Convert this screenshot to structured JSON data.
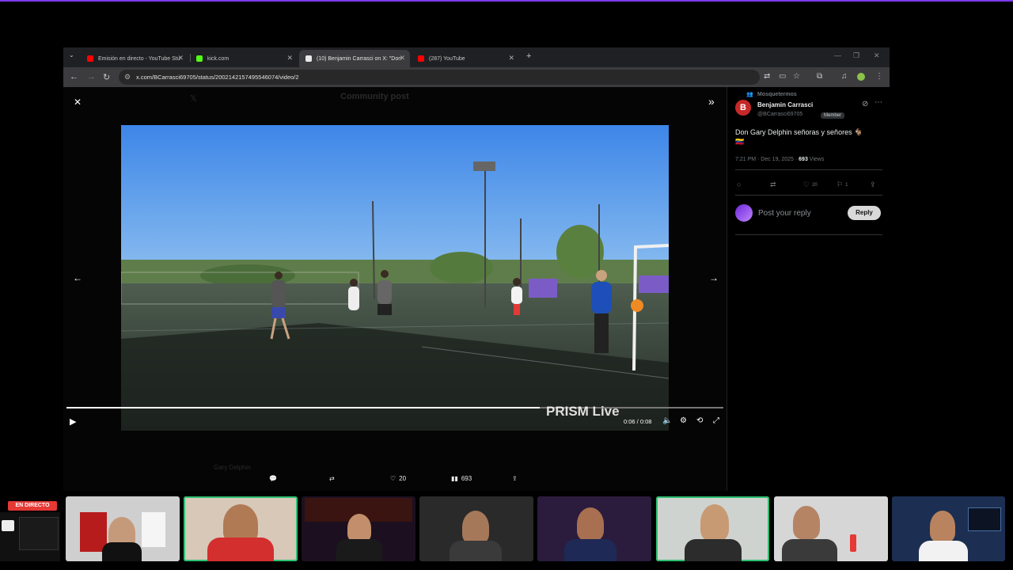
{
  "browser": {
    "tabs": [
      {
        "title": "Emisión en directo - YouTube Stu",
        "color": "#ff0000"
      },
      {
        "title": "kick.com",
        "color": "#53fc18"
      },
      {
        "title": "(10) Benjamin Carrasci on X: \"Don",
        "color": "#e7e9ea"
      },
      {
        "title": "(287) YouTube",
        "color": "#ff0000"
      }
    ],
    "new_tab": "+",
    "url": "x.com/BCarrasci69705/status/2002142157495546074/video/2"
  },
  "viewer": {
    "close": "✕",
    "expand": "»",
    "prev": "←",
    "next": "→",
    "time": "0:06 / 0:08",
    "progress": 0.72,
    "watermark": "PRISM Live",
    "ghost_header": "Community post",
    "ghost_name": "Gary Delphin"
  },
  "bottom_actions": {
    "like_count": "20",
    "view_count": "693"
  },
  "post": {
    "community": "Mosquetermos",
    "author_name": "Benjamin Carrasci",
    "author_handle": "@BCarrasci69705",
    "author_initial": "B",
    "member_badge": "Member",
    "text": "Don Gary Delphin señoras y señores 🐐",
    "flag": "🇻🇪",
    "timestamp": "7:21 PM · Dec 19, 2025 · ",
    "views_count": "693",
    "views_label": " Views",
    "likes": "20",
    "bookmarks": "1",
    "reply_placeholder": "Post your reply",
    "reply_button": "Reply"
  },
  "stream": {
    "live_label": "EN DIRECTO"
  }
}
